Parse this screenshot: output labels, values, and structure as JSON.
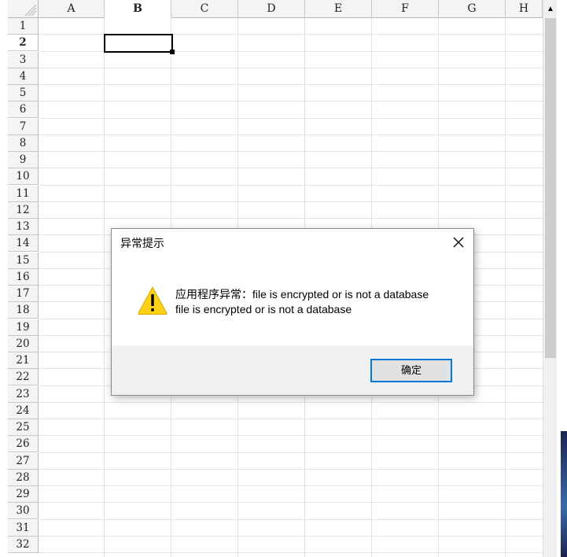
{
  "spreadsheet": {
    "columns": [
      "A",
      "B",
      "C",
      "D",
      "E",
      "F",
      "G",
      "H"
    ],
    "rows": [
      "1",
      "2",
      "3",
      "4",
      "5",
      "6",
      "7",
      "8",
      "9",
      "10",
      "11",
      "12",
      "13",
      "14",
      "15",
      "16",
      "17",
      "18",
      "19",
      "20",
      "21",
      "22",
      "23",
      "24",
      "25",
      "26",
      "27",
      "28",
      "29",
      "30",
      "31",
      "32"
    ],
    "selected_column": "B",
    "selected_row": "2"
  },
  "scrollbar": {
    "up_arrow_icon": "triangle-up"
  },
  "dialog": {
    "title": "异常提示",
    "close_icon": "close-x",
    "warning_icon": "warning-triangle",
    "message_line1": "应用程序异常：file is encrypted or is not a database",
    "message_line2": "file is encrypted or is not a database",
    "ok_label": "确定",
    "accent_color": "#0078d7",
    "warning_color": "#fcd116"
  }
}
